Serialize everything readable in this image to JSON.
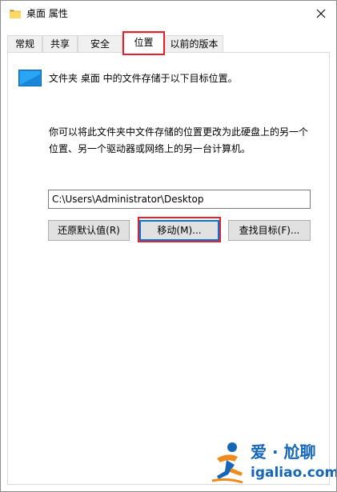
{
  "window": {
    "title": "桌面 属性",
    "close_glyph": "✕"
  },
  "tabs": [
    {
      "label": "常规",
      "active": false
    },
    {
      "label": "共享",
      "active": false
    },
    {
      "label": "安全",
      "active": false
    },
    {
      "label": "位置",
      "active": true
    },
    {
      "label": "以前的版本",
      "active": false
    }
  ],
  "location": {
    "header": "文件夹 桌面 中的文件存储于以下目标位置。",
    "description_line1": "你可以将此文件夹中文件存储的位置更改为此硬盘上的另一个",
    "description_line2": "位置、另一个驱动器或网络上的另一台计算机。",
    "path_value": "C:\\Users\\Administrator\\Desktop"
  },
  "buttons": {
    "restore_default": "还原默认值(R)",
    "move": "移动(M)...",
    "find_target": "查找目标(F)..."
  },
  "watermark": {
    "title": "爱 · 尬聊",
    "url": "igaliao.com"
  },
  "colors": {
    "highlight_red": "#e8202a",
    "folder_blue": "#1e90e8",
    "watermark_blue": "#1566b6",
    "watermark_orange": "#f08a1c"
  }
}
